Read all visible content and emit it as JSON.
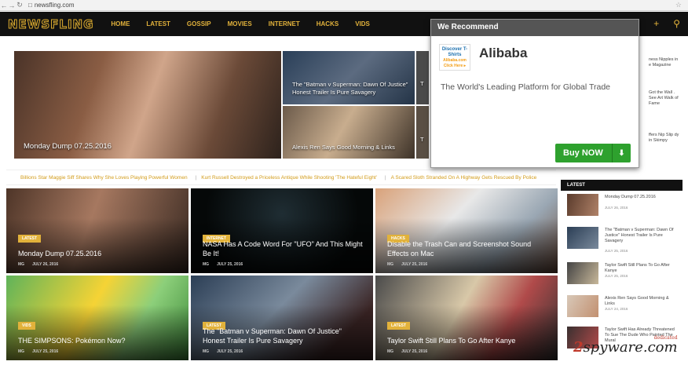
{
  "browser": {
    "url": "newsfling.com"
  },
  "site": {
    "logo": "NEWSFLING",
    "menu": [
      "HOME",
      "LATEST",
      "GOSSIP",
      "MOVIES",
      "INTERNET",
      "HACKS",
      "VIDS"
    ]
  },
  "featured": {
    "hero_title": "Monday Dump 07.25.2016",
    "tile1_title": "The \"Batman v Superman: Dawn Of Justice\" Honest Trailer Is Pure Savagery",
    "tile2_title": "Alexis Ren Says Good Morning & Links",
    "tile3_title": "T",
    "tile4_title": "T"
  },
  "ticker": [
    "Billions Star Maggie Siff Shares Why She Loves Playing Powerful Women",
    "Kurt Russell Destroyed a Priceless Antique While Shooting 'The Hateful Eight'",
    "A Scared Sloth Stranded On A Highway Gets Rescued By Police"
  ],
  "cards": [
    {
      "tag": "LATEST",
      "title": "Monday Dump 07.25.2016",
      "author": "MG",
      "date": "JULY 26, 2016"
    },
    {
      "tag": "INTERNET",
      "title": "NASA Has A Code Word For \"UFO\" And This Might Be It!",
      "author": "MG",
      "date": "JULY 25, 2016"
    },
    {
      "tag": "HACKS",
      "title": "Disable the Trash Can and Screenshot Sound Effects on Mac",
      "author": "MG",
      "date": "JULY 25, 2016"
    },
    {
      "tag": "VIDS",
      "title": "THE SIMPSONS: Pokémon Now?",
      "author": "MG",
      "date": "JULY 25, 2016"
    },
    {
      "tag": "LATEST",
      "title": "The \"Batman v Superman: Dawn Of Justice\" Honest Trailer Is Pure Savagery",
      "author": "MG",
      "date": "JULY 25, 2016"
    },
    {
      "tag": "LATEST",
      "title": "Taylor Swift Still Plans To Go After Kanye",
      "author": "MG",
      "date": "JULY 25, 2016"
    }
  ],
  "sidebar": {
    "partial_items": [
      {
        "text": "ness Nipples in e Magazine"
      },
      {
        "text": "Got the Wall . See Art Walk of Fame"
      },
      {
        "text": "ffers Nip Slip dy in Skimpy"
      }
    ],
    "section_label": "LATEST",
    "items": [
      {
        "title": "Monday Dump 07.25.2016",
        "date": "JULY 26, 2016"
      },
      {
        "title": "The \"Batman v Superman: Dawn Of Justice\" Honest Trailer Is Pure Savagery",
        "date": "JULY 25, 2016"
      },
      {
        "title": "Taylor Swift Still Plans To Go After Kanye",
        "date": "JULY 25, 2016"
      },
      {
        "title": "Alexis Ren Says Good Morning & Links",
        "date": "JULY 24, 2016"
      },
      {
        "title": "Taylor Swift Has Already Threatened To Sue The Dude Who Painted The Mural",
        "date": "JULY 24, 2016"
      }
    ]
  },
  "popup": {
    "header": "We Recommend",
    "ad_img_line1": "Discover T-Shirts",
    "ad_img_line2": "Alibaba.com",
    "ad_img_line3": "Click Here ▸",
    "title": "Alibaba",
    "description": "The World's Leading Platform for Global Trade",
    "button": "Buy NOW",
    "button_icon": "download-icon"
  },
  "watermark": {
    "text1": "2",
    "text2": "spyware",
    "suffix": ".com",
    "tag": "dedicated"
  },
  "colors": {
    "accent": "#e2b23b",
    "nav_bg": "#111111",
    "button": "#2ea12e"
  }
}
